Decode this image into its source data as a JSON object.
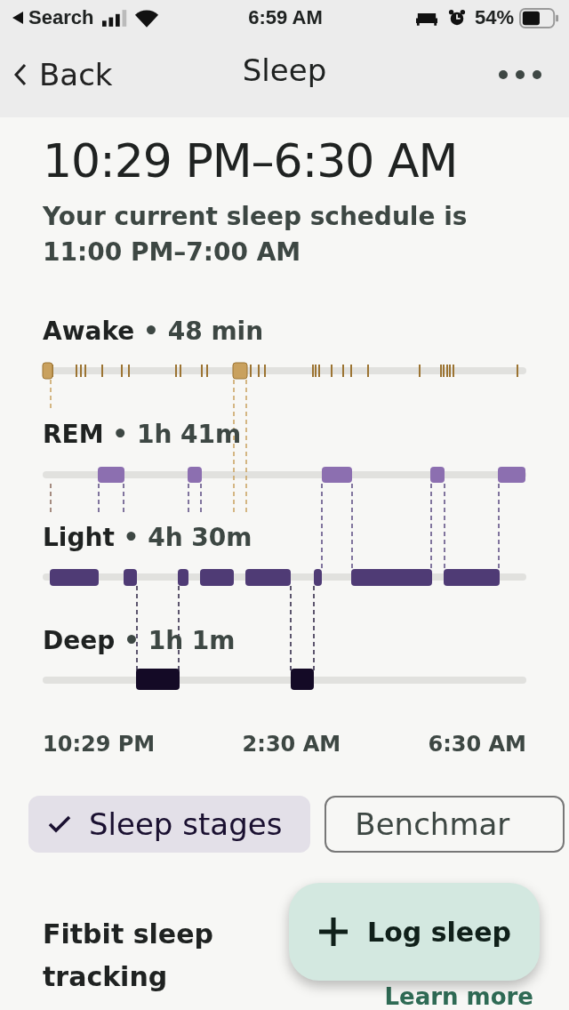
{
  "status_bar": {
    "back_app": "Search",
    "time": "6:59 AM",
    "battery": "54%"
  },
  "nav": {
    "back": "Back",
    "title": "Sleep"
  },
  "header": {
    "range": "10:29 PM–6:30 AM",
    "schedule": "Your current sleep schedule is 11:00 PM–7:00 AM"
  },
  "stages": [
    {
      "name": "Awake",
      "duration": "• 48 min"
    },
    {
      "name": "REM",
      "duration": "• 1h 41m"
    },
    {
      "name": "Light",
      "duration": "• 4h 30m"
    },
    {
      "name": "Deep",
      "duration": "• 1h 1m"
    }
  ],
  "time_labels": [
    "10:29 PM",
    "2:30 AM",
    "6:30 AM"
  ],
  "chips": [
    {
      "label": "Sleep stages",
      "selected": true
    },
    {
      "label": "Benchmar",
      "selected": false
    }
  ],
  "fab": {
    "label": "Log sleep"
  },
  "section": {
    "title": "Fitbit sleep tracking",
    "link": "Learn more"
  }
}
